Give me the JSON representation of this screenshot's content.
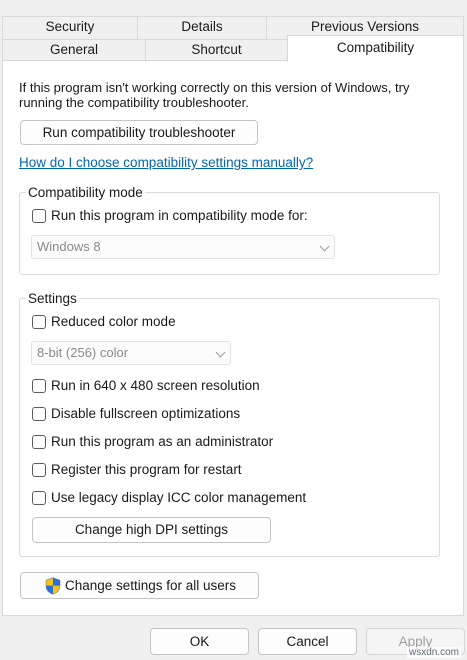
{
  "tabs": {
    "row1": [
      "Security",
      "Details",
      "Previous Versions"
    ],
    "row2": [
      "General",
      "Shortcut",
      "Compatibility"
    ],
    "active": "Compatibility"
  },
  "intro_text_line1": "If this program isn't working correctly on this version of Windows, try",
  "intro_text_line2": "running the compatibility troubleshooter.",
  "troubleshooter_button": "Run compatibility troubleshooter",
  "help_link": "How do I choose compatibility settings manually?",
  "compat_mode": {
    "legend": "Compatibility mode",
    "checkbox_label": "Run this program in compatibility mode for:",
    "checked": false,
    "os_selected": "Windows 8"
  },
  "settings": {
    "legend": "Settings",
    "reduced_color_label": "Reduced color mode",
    "color_selected": "8-bit (256) color",
    "resolution_label": "Run in 640 x 480 screen resolution",
    "fullscreen_label": "Disable fullscreen optimizations",
    "admin_label": "Run this program as an administrator",
    "restart_label": "Register this program for restart",
    "icc_label": "Use legacy display ICC color management",
    "dpi_button": "Change high DPI settings"
  },
  "all_users_button": "Change settings for all users",
  "footer": {
    "ok": "OK",
    "cancel": "Cancel",
    "apply": "Apply"
  },
  "watermark": "wsxdn.com",
  "colors": {
    "link": "#0066b4",
    "shield_blue": "#2b6fd6",
    "shield_yellow": "#f4c417"
  }
}
